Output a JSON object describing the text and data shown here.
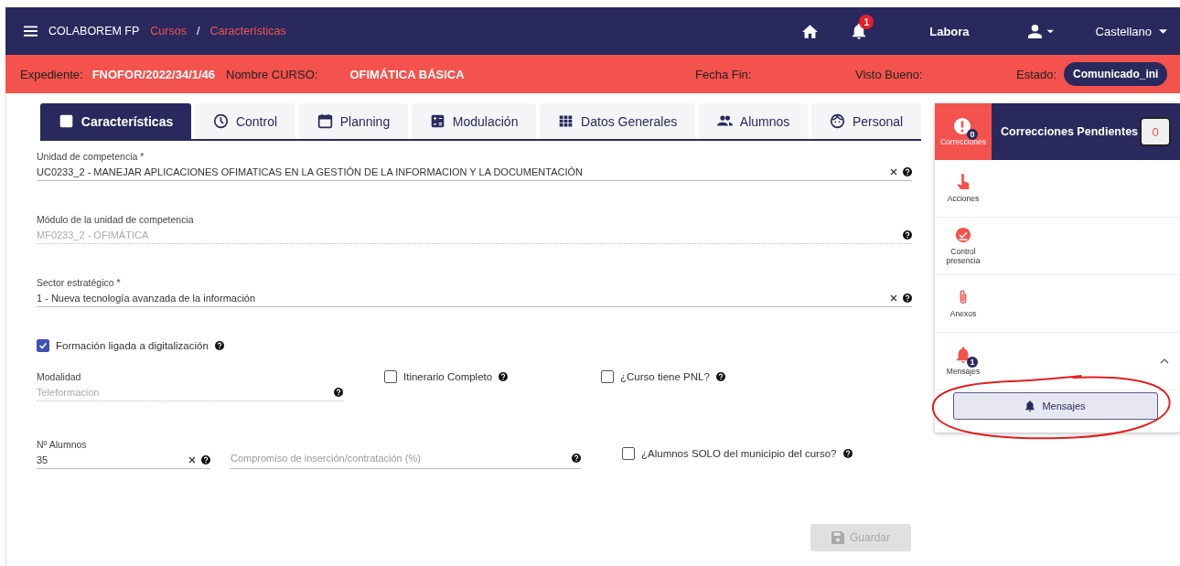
{
  "navbar": {
    "brand": "COLABOREM FP",
    "breadcrumb": [
      "Cursos",
      "/",
      "Características"
    ],
    "notification_count": "1",
    "user_org": "Labora",
    "language": "Castellano"
  },
  "info_bar": {
    "items": [
      {
        "label": "Expediente:",
        "value": "FNOFOR/2022/34/1/46"
      },
      {
        "label": "Nombre CURSO:",
        "value": "OFIMÁTICA BÁSICA"
      },
      {
        "label": "Fecha Fin:"
      },
      {
        "label": "Visto Bueno:"
      },
      {
        "label": "Estado:",
        "status": "Comunicado_ini"
      }
    ]
  },
  "tabs": [
    {
      "label": "Características",
      "selected": true
    },
    {
      "label": "Control",
      "selected": false
    },
    {
      "label": "Planning",
      "selected": false
    },
    {
      "label": "Modulación",
      "selected": false
    },
    {
      "label": "Datos Generales",
      "selected": false
    },
    {
      "label": "Alumnos",
      "selected": false
    },
    {
      "label": "Personal",
      "selected": false
    }
  ],
  "fields": [
    {
      "kind": "select",
      "label": "Unidad de competencia *",
      "value": "UC0233_2 - MANEJAR APLICACIONES OFIMATICAS EN LA GESTIÓN DE LA INFORMACION Y LA DOCUMENTACIÓN"
    },
    {
      "kind": "readonly",
      "label": "Módulo de la unidad de competencia",
      "value": "MF0233_2 - OFIMÁTICA"
    },
    {
      "kind": "select",
      "label": "Sector estratégico *",
      "value": "1 - Nueva tecnología avanzada de la información"
    }
  ],
  "digital_checkbox": {
    "label": "Formación ligada a digitalización",
    "checked": true
  },
  "modalidad": {
    "label": "Modalidad",
    "value": "Teleformacion"
  },
  "itinerario_checkbox": {
    "label": "Itinerario Completo",
    "checked": false
  },
  "pnl_checkbox": {
    "label": "¿Curso tiene PNL?",
    "checked": false
  },
  "alumnos": {
    "label": "Nº Alumnos",
    "value": "35"
  },
  "compromiso": {
    "placeholder": "Compromiso de inserción/contratación (%)"
  },
  "municipio_checkbox": {
    "label": "¿Alumnos SOLO del municipio del curso?",
    "checked": false
  },
  "save_button": {
    "label": "Guardar",
    "disabled": true
  },
  "side_panel": {
    "header": {
      "label": "Correcciones",
      "badge": "0",
      "title": "Correcciones Pendientes",
      "count": "0"
    },
    "items": [
      {
        "kind": "hand",
        "label": "Acciones"
      },
      {
        "kind": "check",
        "label": "Control presencia"
      },
      {
        "kind": "clip",
        "label": "Anexos"
      },
      {
        "kind": "bell",
        "label": "Mensajes",
        "badge": "1",
        "expanded": true,
        "button": "Mensajes"
      }
    ]
  }
}
